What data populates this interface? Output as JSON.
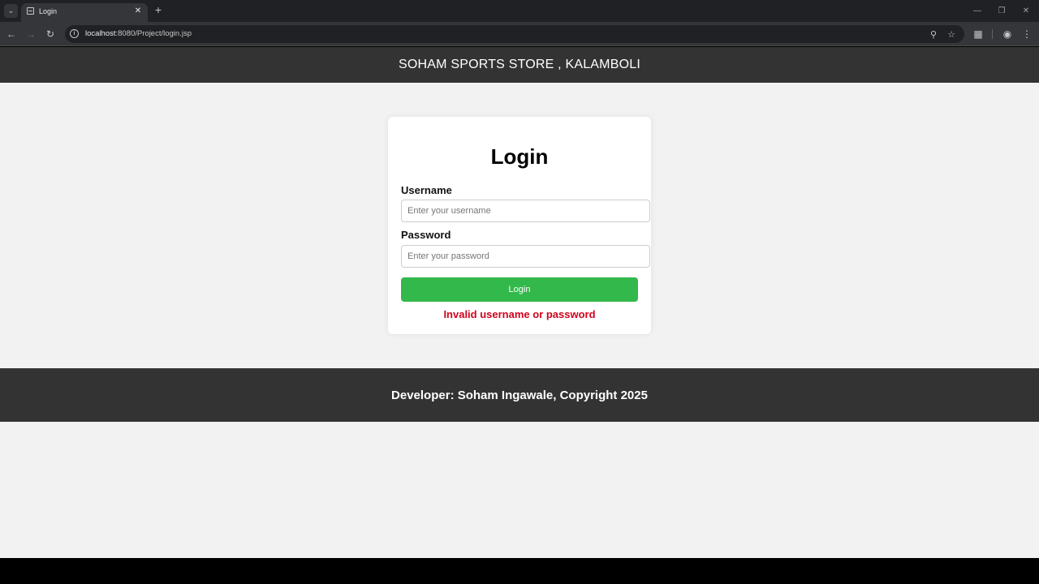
{
  "browser": {
    "tab_title": "Login",
    "url_host": "localhost",
    "url_rest": ":8080/Project/login.jsp",
    "icons": {
      "tab_search": "chevron-down-icon",
      "tab_close": "close-icon",
      "new_tab": "plus-icon",
      "back": "arrow-left-icon",
      "forward": "arrow-right-icon",
      "reload": "reload-icon",
      "site_info": "info-icon",
      "zoom": "zoom-icon",
      "bookmark": "star-icon",
      "extensions": "puzzle-icon",
      "profile": "profile-icon",
      "menu": "kebab-menu-icon"
    }
  },
  "header": {
    "title": "SOHAM SPORTS STORE , KALAMBOLI"
  },
  "login": {
    "heading": "Login",
    "username_label": "Username",
    "username_placeholder": "Enter your username",
    "password_label": "Password",
    "password_placeholder": "Enter your password",
    "submit_label": "Login",
    "error_message": "Invalid username or password"
  },
  "footer": {
    "text": "Developer: Soham Ingawale, Copyright 2025"
  },
  "colors": {
    "header_bg": "#333333",
    "page_bg": "#f2f2f2",
    "button_bg": "#32b84b",
    "error": "#d0021b"
  }
}
